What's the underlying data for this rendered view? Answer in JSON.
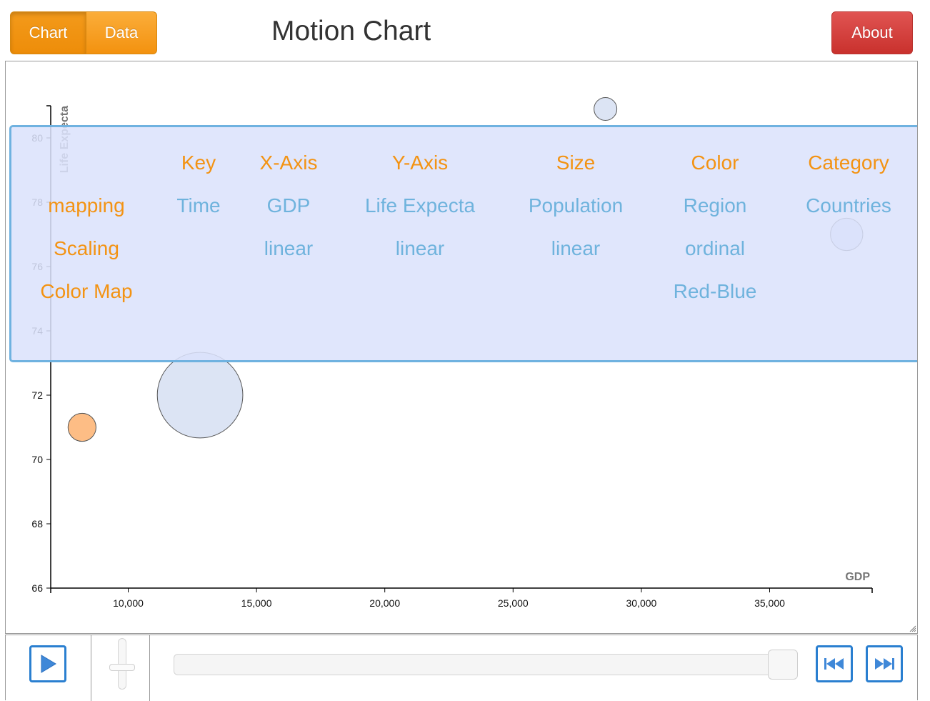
{
  "toolbar": {
    "chart_label": "Chart",
    "data_label": "Data",
    "title": "Motion Chart",
    "about_label": "About"
  },
  "colors": {
    "orange": "#f39313",
    "blue_text": "#6fb3dd",
    "button_blue": "#2a7fd0",
    "bubble_blue": "#dae3f3",
    "bubble_orange": "#fdb97e"
  },
  "overlay": {
    "headers": {
      "key": "Key",
      "x_axis": "X-Axis",
      "y_axis": "Y-Axis",
      "size": "Size",
      "color": "Color",
      "category": "Category"
    },
    "rows": {
      "mapping": {
        "label": "mapping",
        "key": "Time",
        "x_axis": "GDP",
        "y_axis": "Life Expecta",
        "size": "Population",
        "color": "Region",
        "category": "Countries"
      },
      "scaling": {
        "label": "Scaling",
        "x_axis": "linear",
        "y_axis": "linear",
        "size": "linear",
        "color": "ordinal"
      },
      "color_map": {
        "label": "Color Map",
        "color": "Red-Blue"
      }
    }
  },
  "chart_data": {
    "type": "scatter",
    "title": "",
    "xlabel": "GDP",
    "ylabel": "Life Expecta",
    "xlim": [
      7000,
      39000
    ],
    "ylim": [
      66,
      81
    ],
    "x_ticks": [
      10000,
      15000,
      20000,
      25000,
      30000,
      35000
    ],
    "x_tick_labels": [
      "10,000",
      "15,000",
      "20,000",
      "25,000",
      "30,000",
      "35,000"
    ],
    "y_ticks": [
      66,
      68,
      70,
      72,
      74,
      76,
      78,
      80
    ],
    "y_tick_labels": [
      "66",
      "68",
      "70",
      "72",
      "74",
      "76",
      "78",
      "80"
    ],
    "grid": false,
    "points": [
      {
        "x": 28600,
        "y": 80.9,
        "size": 1,
        "color": "#dae3f3"
      },
      {
        "x": 12800,
        "y": 72.0,
        "size": 14,
        "color": "#dae3f3"
      },
      {
        "x": 8200,
        "y": 71.0,
        "size": 1.5,
        "color": "#fdb97e"
      },
      {
        "x": 38000,
        "y": 77.0,
        "size": 2,
        "color": "#dae3f3"
      }
    ]
  },
  "controls": {
    "play_icon": "play-icon",
    "vertical_slider_level": 0.5,
    "timeline_position": 1.0,
    "skip_back_icon": "skip-back-icon",
    "skip_forward_icon": "skip-forward-icon"
  }
}
